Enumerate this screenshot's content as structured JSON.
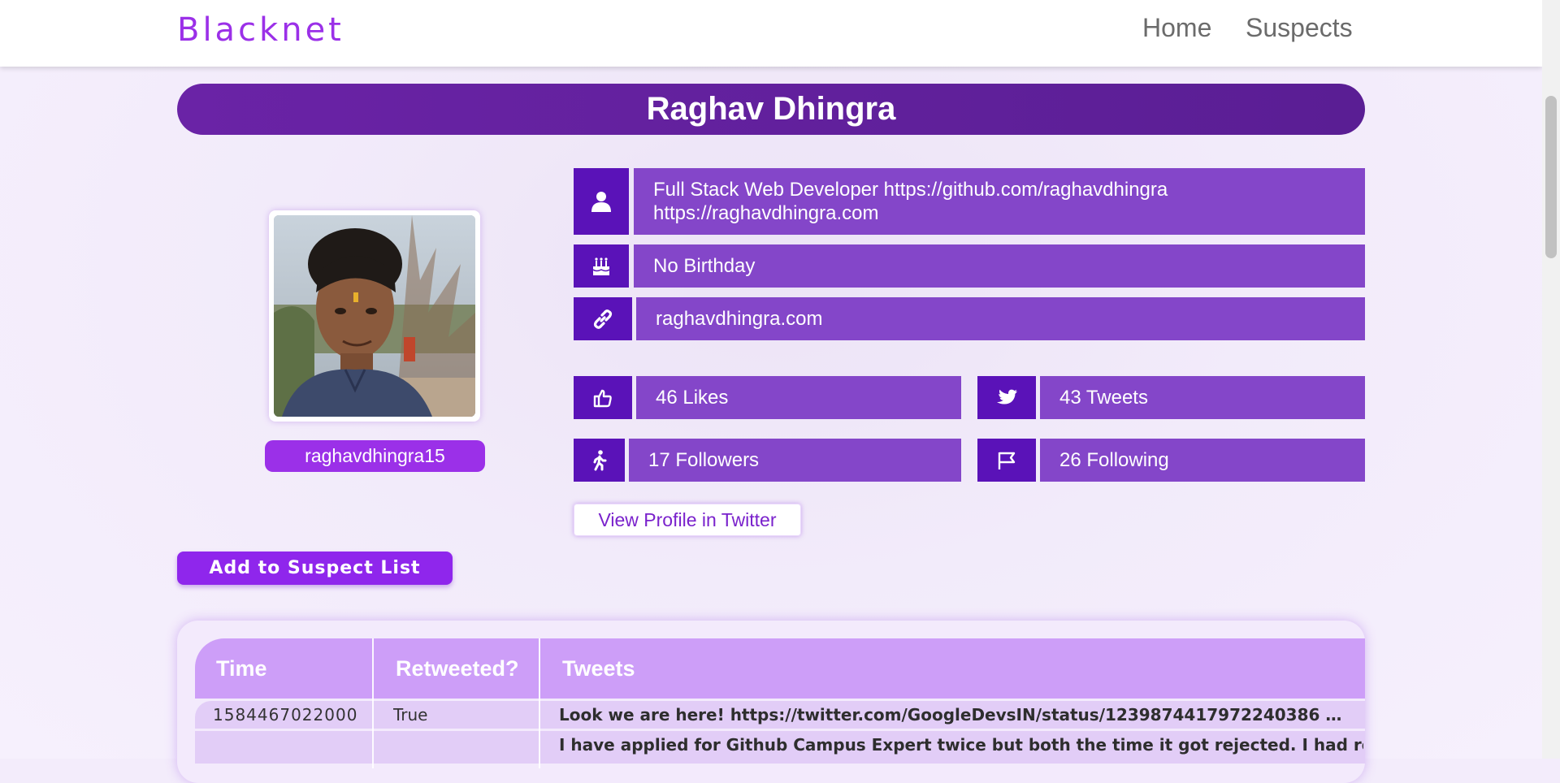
{
  "navbar": {
    "brand": "Blacknet",
    "links": [
      "Home",
      "Suspects"
    ]
  },
  "profile": {
    "name": "Raghav Dhingra",
    "username": "raghavdhingra15",
    "bio_line1": "Full Stack Web Developer https://github.com/raghavdhingra",
    "bio_line2": "https://raghavdhingra.com",
    "birthday": "No Birthday",
    "website": "raghavdhingra.com",
    "likes": "46 Likes",
    "tweets": "43 Tweets",
    "followers": "17 Followers",
    "following": "26 Following"
  },
  "buttons": {
    "view_profile": "View Profile in Twitter",
    "add_suspect": "Add to Suspect List"
  },
  "icons": {
    "bio": "user-icon",
    "birthday": "cake-icon",
    "website": "link-icon",
    "likes": "thumbs-up-icon",
    "tweets": "twitter-icon",
    "followers": "walking-person-icon",
    "following": "flag-icon"
  },
  "table": {
    "headers": [
      "Time",
      "Retweeted?",
      "Tweets"
    ],
    "rows": [
      {
        "time": "1584467022000",
        "retweeted": "True",
        "tweet": "Look we are here! https://twitter.com/GoogleDevsIN/status/1239874417972240386 …"
      },
      {
        "time": "",
        "retweeted": "",
        "tweet": "I have applied for Github Campus Expert twice but both the time it got rejected. I had read"
      }
    ]
  },
  "colors": {
    "brand": "#9b30e8",
    "banner": "#6a23a6",
    "icon_box": "#5a12b8",
    "info_box": "#8446c9",
    "table_header": "#cd9ef8",
    "table_row": "#e2cdf7"
  }
}
